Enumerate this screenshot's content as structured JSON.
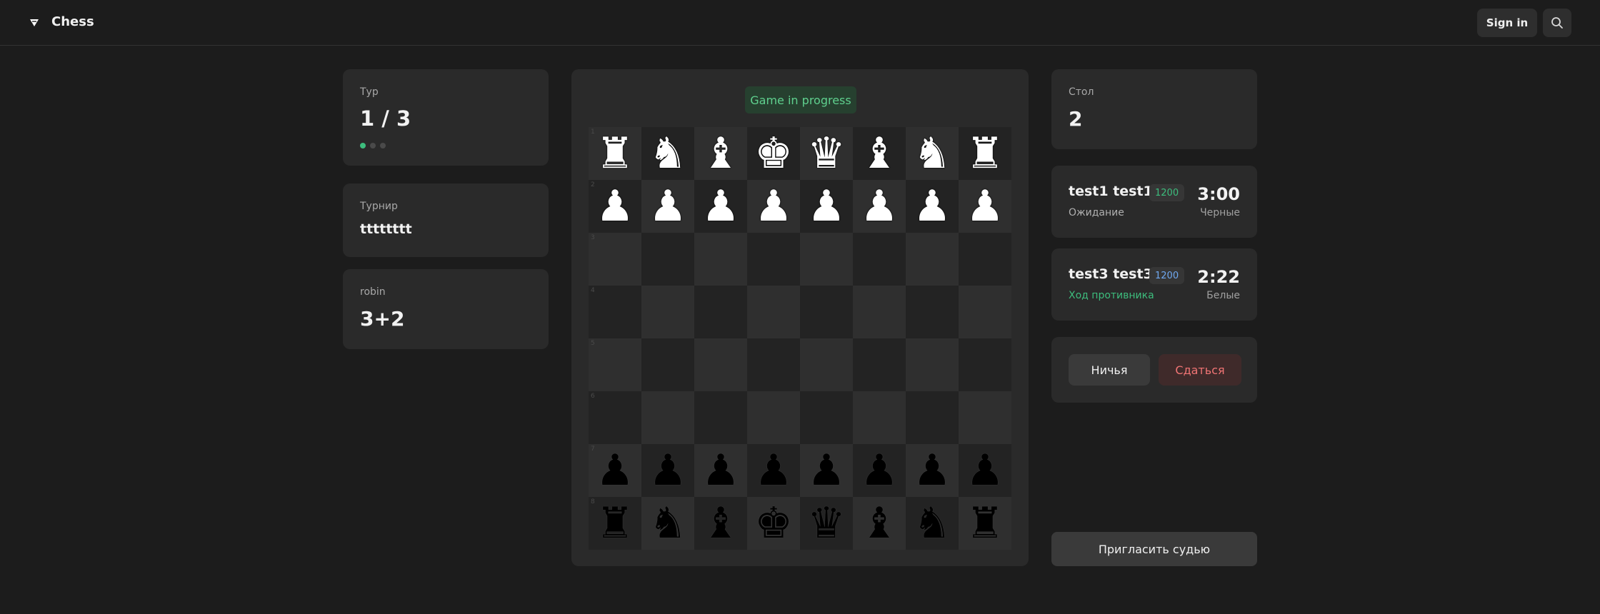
{
  "header": {
    "app_title": "Chess",
    "signin_label": "Sign in"
  },
  "left": {
    "round": {
      "label": "Тур",
      "value": "1 / 3",
      "dots_total": 3,
      "dots_active": 1
    },
    "tournament": {
      "label": "Турнир",
      "value": "tttttttt"
    },
    "format": {
      "label": "robin",
      "value": "3+2"
    }
  },
  "board": {
    "status": "Game in progress",
    "ranks": [
      [
        "R",
        "N",
        "B",
        "K",
        "Q",
        "B",
        "N",
        "R"
      ],
      [
        "P",
        "P",
        "P",
        "P",
        "P",
        "P",
        "P",
        "P"
      ],
      [
        "",
        "",
        "",
        "",
        "",
        "",
        "",
        ""
      ],
      [
        "",
        "",
        "",
        "",
        "",
        "",
        "",
        ""
      ],
      [
        "",
        "",
        "",
        "",
        "",
        "",
        "",
        ""
      ],
      [
        "",
        "",
        "",
        "",
        "",
        "",
        "",
        ""
      ],
      [
        "p",
        "p",
        "p",
        "p",
        "p",
        "p",
        "p",
        "p"
      ],
      [
        "r",
        "n",
        "b",
        "k",
        "q",
        "b",
        "n",
        "r"
      ]
    ],
    "rank_labels": [
      "1",
      "2",
      "3",
      "4",
      "5",
      "6",
      "7",
      "8"
    ]
  },
  "right": {
    "table": {
      "label": "Стол",
      "value": "2"
    },
    "opponent": {
      "name": "test1 test1",
      "rating": "1200",
      "status": "Ожидание",
      "time": "3:00",
      "color": "Черные"
    },
    "me": {
      "name": "test3 test3",
      "rating": "1200",
      "status": "Ход противника",
      "time": "2:22",
      "color": "Белые"
    },
    "actions": {
      "draw_label": "Ничья",
      "resign_label": "Сдаться"
    },
    "invite_label": "Пригласить судью"
  },
  "colors": {
    "accent_green": "#3dbd7d",
    "status_green": "#5fd08e",
    "rating_blue": "#6fa8f0",
    "danger_red": "#f07474"
  },
  "icons": {
    "logo": "chess-logo-icon",
    "search": "search-icon"
  }
}
